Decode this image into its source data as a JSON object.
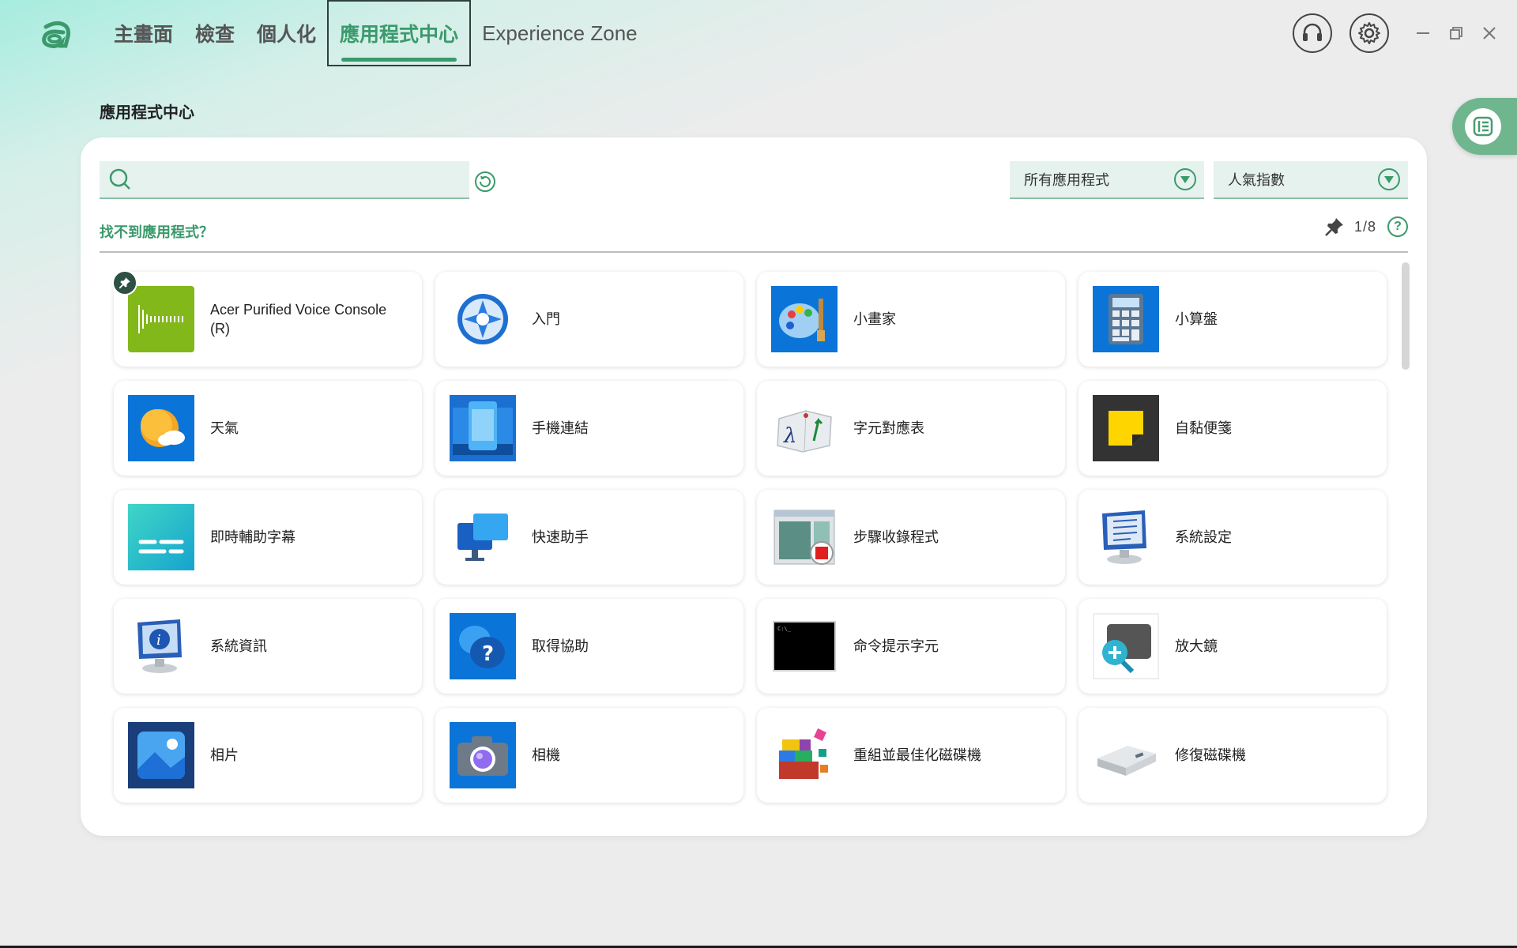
{
  "nav": {
    "tabs": [
      {
        "label": "主畫面"
      },
      {
        "label": "檢查"
      },
      {
        "label": "個人化"
      },
      {
        "label": "應用程式中心",
        "active": true
      },
      {
        "label": "Experience Zone"
      }
    ]
  },
  "page": {
    "title": "應用程式中心"
  },
  "search": {
    "placeholder": "",
    "value": ""
  },
  "filters": {
    "category": {
      "selected": "所有應用程式"
    },
    "sort": {
      "selected": "人氣指數"
    }
  },
  "links": {
    "not_found": "找不到應用程式？"
  },
  "pin_status": {
    "count": "1/8"
  },
  "apps": [
    {
      "label": "Acer Purified Voice Console (R)",
      "icon": "acer-voice-icon",
      "pinned": true
    },
    {
      "label": "入門",
      "icon": "get-started-icon"
    },
    {
      "label": "小畫家",
      "icon": "paint-icon"
    },
    {
      "label": "小算盤",
      "icon": "calculator-icon"
    },
    {
      "label": "天氣",
      "icon": "weather-icon"
    },
    {
      "label": "手機連結",
      "icon": "phone-link-icon"
    },
    {
      "label": "字元對應表",
      "icon": "character-map-icon"
    },
    {
      "label": "自黏便箋",
      "icon": "sticky-notes-icon"
    },
    {
      "label": "即時輔助字幕",
      "icon": "live-captions-icon"
    },
    {
      "label": "快速助手",
      "icon": "quick-assist-icon"
    },
    {
      "label": "步驟收錄程式",
      "icon": "steps-recorder-icon"
    },
    {
      "label": "系統設定",
      "icon": "system-config-icon"
    },
    {
      "label": "系統資訊",
      "icon": "system-info-icon"
    },
    {
      "label": "取得協助",
      "icon": "get-help-icon"
    },
    {
      "label": "命令提示字元",
      "icon": "command-prompt-icon"
    },
    {
      "label": "放大鏡",
      "icon": "magnifier-icon"
    },
    {
      "label": "相片",
      "icon": "photos-icon"
    },
    {
      "label": "相機",
      "icon": "camera-icon"
    },
    {
      "label": "重組並最佳化磁碟機",
      "icon": "defragment-icon"
    },
    {
      "label": "修復磁碟機",
      "icon": "recovery-drive-icon"
    }
  ],
  "colors": {
    "accent": "#3a9a6b",
    "panel": "#ffffff",
    "background": "#ececec"
  }
}
